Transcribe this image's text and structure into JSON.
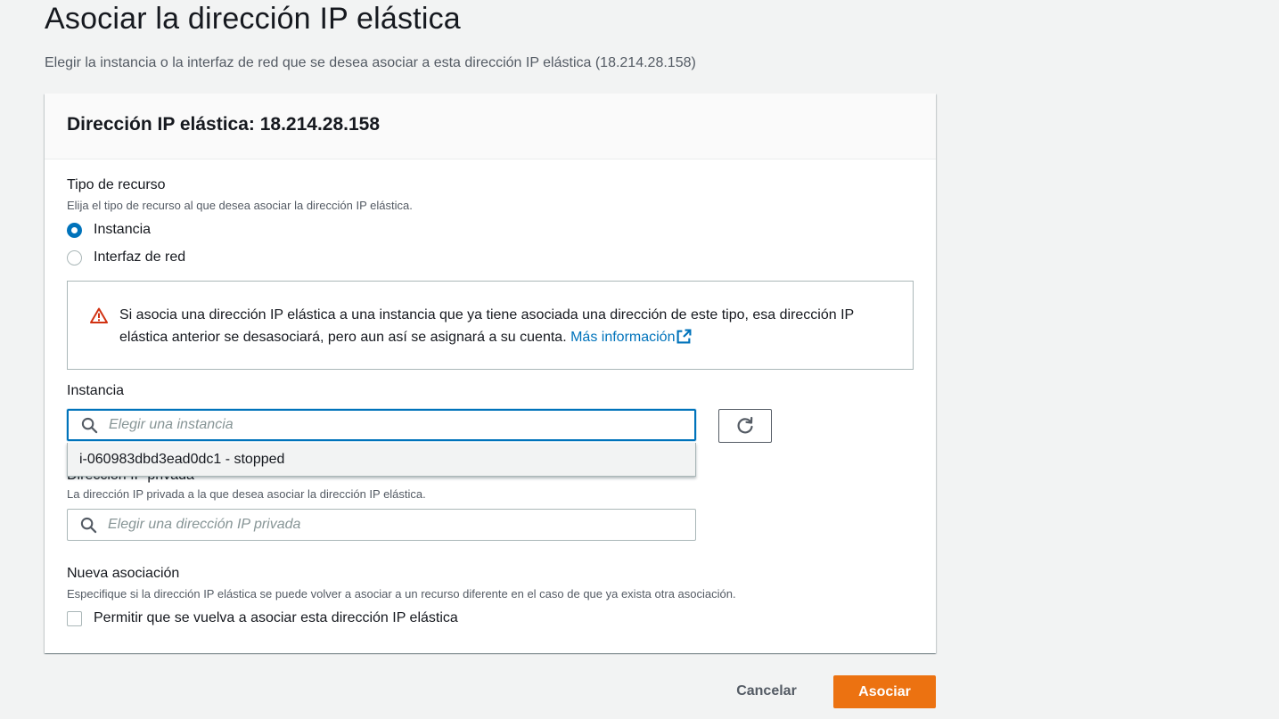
{
  "page": {
    "title": "Asociar la dirección IP elástica",
    "subtitle": "Elegir la instancia o la interfaz de red que se desea asociar a esta dirección IP elástica (18.214.28.158)"
  },
  "panel": {
    "header": "Dirección IP elástica: 18.214.28.158",
    "resource_type": {
      "label": "Tipo de recurso",
      "description": "Elija el tipo de recurso al que desea asociar la dirección IP elástica.",
      "options": [
        {
          "label": "Instancia",
          "selected": true
        },
        {
          "label": "Interfaz de red",
          "selected": false
        }
      ]
    },
    "alert": {
      "icon": "warning-icon",
      "text": "Si asocia una dirección IP elástica a una instancia que ya tiene asociada una dirección de este tipo, esa dirección IP elástica anterior se desasociará, pero aun así se asignará a su cuenta.",
      "link_label": "Más información"
    },
    "instance": {
      "label": "Instancia",
      "placeholder": "Elegir una instancia",
      "dropdown_options": [
        "i-060983dbd3ead0dc1 - stopped"
      ]
    },
    "private_ip": {
      "label": "Dirección IP privada",
      "description": "La dirección IP privada a la que desea asociar la dirección IP elástica.",
      "placeholder": "Elegir una dirección IP privada"
    },
    "reassociation": {
      "label": "Nueva asociación",
      "description": "Especifique si la dirección IP elástica se puede volver a asociar a un recurso diferente en el caso de que ya exista otra asociación.",
      "checkbox_label": "Permitir que se vuelva a asociar esta dirección IP elástica",
      "checked": false
    }
  },
  "actions": {
    "cancel_label": "Cancelar",
    "submit_label": "Asociar"
  },
  "colors": {
    "primary": "#ec7211",
    "link": "#0073bb",
    "warning": "#d13212",
    "background": "#f2f3f3"
  }
}
